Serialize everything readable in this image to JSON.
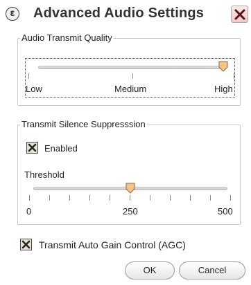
{
  "window": {
    "title": "Advanced Audio Settings",
    "app_icon_glyph": "ε",
    "close_icon": "close-icon"
  },
  "transmit_quality": {
    "group_label": "Audio Transmit Quality",
    "labels": [
      "Low",
      "Medium",
      "High"
    ],
    "selected": "High"
  },
  "silence_suppression": {
    "group_label": "Transmit Silence Suppresssion",
    "enabled_label": "Enabled",
    "enabled_checked": true,
    "threshold_label": "Threshold",
    "scale": [
      "0",
      "250",
      "500"
    ],
    "threshold_value": 250
  },
  "agc": {
    "label": "Transmit Auto Gain Control (AGC)",
    "checked": true
  },
  "buttons": {
    "ok": "OK",
    "cancel": "Cancel"
  },
  "colors": {
    "thumb_fill": "#f2c58a",
    "check_x": "#222222"
  }
}
